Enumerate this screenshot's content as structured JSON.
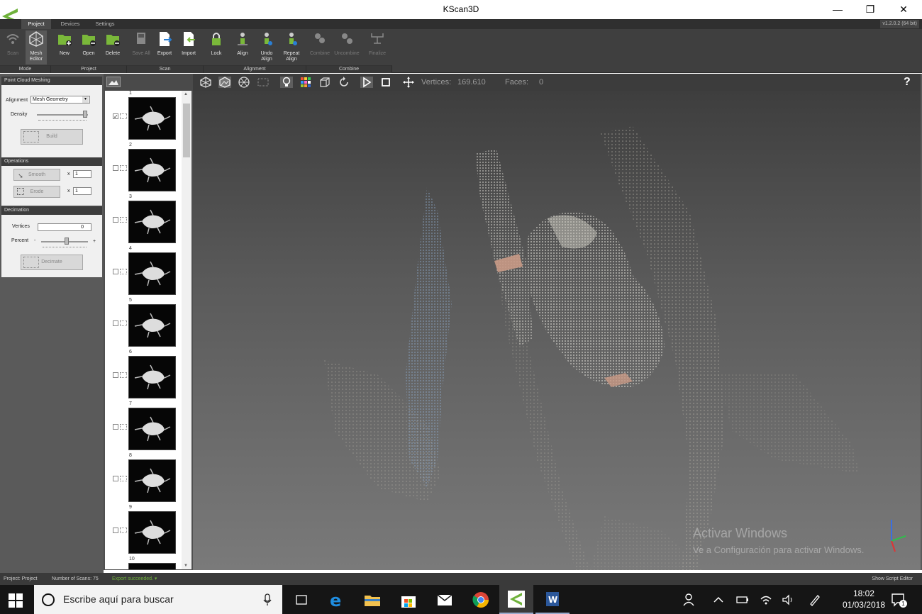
{
  "window": {
    "title": "KScan3D",
    "version": "v1.2.0.2 (64 bit)"
  },
  "tabs": [
    "Project",
    "Devices",
    "Settings"
  ],
  "ribbon": {
    "buttons": [
      {
        "label": "Scan",
        "icon": "wifi-scan-icon"
      },
      {
        "label": "Mesh Editor",
        "icon": "mesh-editor-icon"
      },
      {
        "label": "New",
        "icon": "new-folder-icon"
      },
      {
        "label": "Open",
        "icon": "open-folder-icon"
      },
      {
        "label": "Delete",
        "icon": "delete-folder-icon"
      },
      {
        "label": "Save All",
        "icon": "save-all-icon"
      },
      {
        "label": "Export",
        "icon": "export-icon"
      },
      {
        "label": "Import",
        "icon": "import-icon"
      },
      {
        "label": "Lock",
        "icon": "lock-icon"
      },
      {
        "label": "Align",
        "icon": "align-icon"
      },
      {
        "label": "Undo Align",
        "icon": "undo-align-icon"
      },
      {
        "label": "Repeat Align",
        "icon": "repeat-align-icon"
      },
      {
        "label": "Combine",
        "icon": "combine-icon"
      },
      {
        "label": "Uncombine",
        "icon": "uncombine-icon"
      },
      {
        "label": "Finalize",
        "icon": "finalize-icon"
      }
    ],
    "groups": [
      "Mode",
      "Project",
      "Scan",
      "Alignment",
      "Combine"
    ]
  },
  "left_panel": {
    "meshing": {
      "header": "Point Cloud Meshing",
      "alignment_label": "Alignment",
      "alignment_value": "Mesh Geometry",
      "density_label": "Density",
      "density_level": 0.95,
      "build_label": "Build"
    },
    "operations": {
      "header": "Operations",
      "smooth_label": "Smooth",
      "smooth_x": "x",
      "smooth_value": "1",
      "erode_label": "Erode",
      "erode_x": "x",
      "erode_value": "1"
    },
    "decimation": {
      "header": "Decimation",
      "vertices_label": "Vertices",
      "vertices_value": "0",
      "percent_label": "Percent",
      "percent_minus": "-",
      "percent_plus": "+",
      "percent_level": 0.55,
      "decimate_label": "Decimate"
    }
  },
  "scans": [
    {
      "num": "1",
      "checked": true
    },
    {
      "num": "2",
      "checked": false
    },
    {
      "num": "3",
      "checked": false
    },
    {
      "num": "4",
      "checked": false
    },
    {
      "num": "5",
      "checked": false
    },
    {
      "num": "6",
      "checked": false
    },
    {
      "num": "7",
      "checked": false
    },
    {
      "num": "8",
      "checked": false
    },
    {
      "num": "9",
      "checked": false
    },
    {
      "num": "10",
      "checked": false
    }
  ],
  "viewport": {
    "vertices_label": "Vertices:",
    "vertices_value": "169.610",
    "faces_label": "Faces:",
    "faces_value": "0",
    "help": "?",
    "watermark_line1": "Activar Windows",
    "watermark_line2": "Ve a Configuración para activar Windows."
  },
  "status": {
    "project": "Project: Project",
    "scans": "Number of Scans: 75",
    "export": "Export succeeded.",
    "script": "Show Script Editor"
  },
  "taskbar": {
    "search_placeholder": "Escribe aquí para buscar",
    "time": "18:02",
    "date": "01/03/2018",
    "notifications": "1"
  },
  "colors": {
    "accent": "#7ab83a",
    "ribbon": "#3f3f3f",
    "panel": "#f0f0f0"
  }
}
